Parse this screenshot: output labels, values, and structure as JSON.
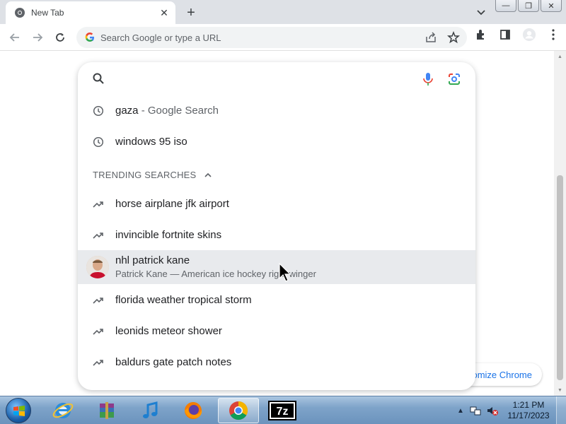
{
  "browser": {
    "tab_title": "New Tab",
    "tab_close": "✕",
    "new_tab": "+",
    "window_buttons": [
      "—",
      "❐",
      "✕"
    ],
    "omnibox_placeholder": "Search Google or type a URL"
  },
  "search_dropdown": {
    "recent": [
      {
        "query": "gaza",
        "suffix": " - Google Search",
        "icon": "history-icon"
      },
      {
        "query": "windows 95 iso",
        "suffix": "",
        "icon": "history-icon"
      }
    ],
    "trending_title": "TRENDING SEARCHES",
    "trending": [
      {
        "query": "horse airplane jfk airport",
        "icon": "trending-icon"
      },
      {
        "query": "invincible fortnite skins",
        "icon": "trending-icon"
      },
      {
        "query": "nhl patrick kane",
        "subtitle": "Patrick Kane — American ice hockey right winger",
        "icon": "entity-thumbnail",
        "active": true
      },
      {
        "query": "florida weather tropical storm",
        "icon": "trending-icon"
      },
      {
        "query": "leonids meteor shower",
        "icon": "trending-icon"
      },
      {
        "query": "baldurs gate patch notes",
        "icon": "trending-icon"
      }
    ]
  },
  "page": {
    "customize_label": "Customize Chrome"
  },
  "taskbar": {
    "apps": [
      "Internet Explorer",
      "WinRAR",
      "iTunes",
      "Firefox",
      "Chrome",
      "7-Zip"
    ],
    "active_app": "Chrome",
    "time": "1:21 PM",
    "date": "11/17/2023"
  },
  "colors": {
    "accent": "#1a73e8",
    "highlight": "#e8eaed",
    "text_primary": "#202124",
    "text_secondary": "#5f6368"
  }
}
